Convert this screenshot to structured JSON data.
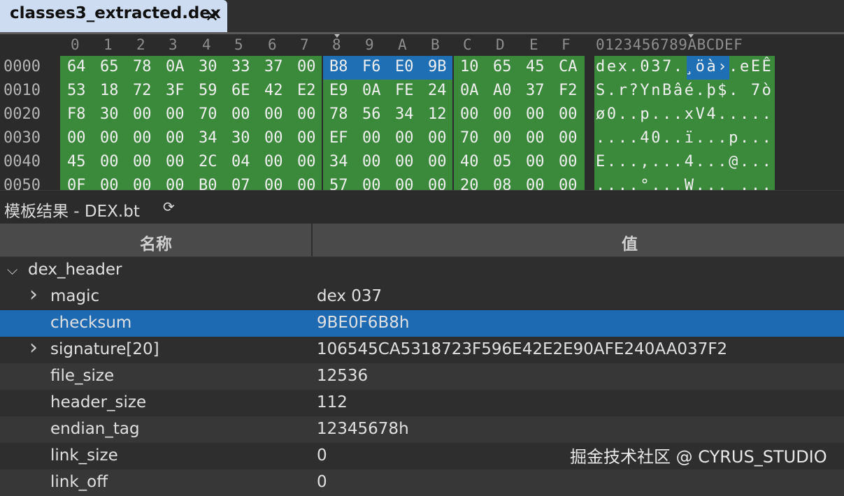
{
  "tab": {
    "title": "classes3_extracted.dex",
    "close": "✕"
  },
  "hex_header": {
    "columns": [
      "0",
      "1",
      "2",
      "3",
      "4",
      "5",
      "6",
      "7",
      "8",
      "9",
      "A",
      "B",
      "C",
      "D",
      "E",
      "F"
    ],
    "ascii_header": "0123456789ABCDEF"
  },
  "hex_rows": [
    {
      "offset": "0000",
      "bytes": [
        "64",
        "65",
        "78",
        "0A",
        "30",
        "33",
        "37",
        "00",
        "B8",
        "F6",
        "E0",
        "9B",
        "10",
        "65",
        "45",
        "CA"
      ],
      "ascii": "dex.037.¸öà›.eEÊ"
    },
    {
      "offset": "0010",
      "bytes": [
        "53",
        "18",
        "72",
        "3F",
        "59",
        "6E",
        "42",
        "E2",
        "E9",
        "0A",
        "FE",
        "24",
        "0A",
        "A0",
        "37",
        "F2"
      ],
      "ascii": "S.r?YnBâé.þ$. 7ò"
    },
    {
      "offset": "0020",
      "bytes": [
        "F8",
        "30",
        "00",
        "00",
        "70",
        "00",
        "00",
        "00",
        "78",
        "56",
        "34",
        "12",
        "00",
        "00",
        "00",
        "00"
      ],
      "ascii": "ø0..p...xV4....."
    },
    {
      "offset": "0030",
      "bytes": [
        "00",
        "00",
        "00",
        "00",
        "34",
        "30",
        "00",
        "00",
        "EF",
        "00",
        "00",
        "00",
        "70",
        "00",
        "00",
        "00"
      ],
      "ascii": "....40..ï...p..."
    },
    {
      "offset": "0040",
      "bytes": [
        "45",
        "00",
        "00",
        "00",
        "2C",
        "04",
        "00",
        "00",
        "34",
        "00",
        "00",
        "00",
        "40",
        "05",
        "00",
        "00"
      ],
      "ascii": "E...,...4...@..."
    },
    {
      "offset": "0050",
      "bytes": [
        "0F",
        "00",
        "00",
        "00",
        "B0",
        "07",
        "00",
        "00",
        "57",
        "00",
        "00",
        "00",
        "20",
        "08",
        "00",
        "00"
      ],
      "ascii": "....°...W... ..."
    }
  ],
  "panel": {
    "title": "模板结果 - DEX.bt",
    "refresh_icon": "refresh-icon"
  },
  "columns": {
    "name": "名称",
    "value": "值"
  },
  "tree": [
    {
      "name": "dex_header",
      "value": "",
      "level": 0,
      "expand": "expanded"
    },
    {
      "name": "magic",
      "value": "dex 037",
      "level": 1,
      "expand": "collapsed"
    },
    {
      "name": "checksum",
      "value": "9BE0F6B8h",
      "level": 1,
      "expand": "none",
      "selected": true
    },
    {
      "name": "signature[20]",
      "value": "106545CA5318723F596E42E2E90AFE240AA037F2",
      "level": 1,
      "expand": "collapsed"
    },
    {
      "name": "file_size",
      "value": "12536",
      "level": 1,
      "expand": "none"
    },
    {
      "name": "header_size",
      "value": "112",
      "level": 1,
      "expand": "none"
    },
    {
      "name": "endian_tag",
      "value": "12345678h",
      "level": 1,
      "expand": "none"
    },
    {
      "name": "link_size",
      "value": "0",
      "level": 1,
      "expand": "none"
    },
    {
      "name": "link_off",
      "value": "0",
      "level": 1,
      "expand": "none"
    }
  ],
  "watermark": "掘金技术社区 @ CYRUS_STUDIO",
  "colors": {
    "green": "#3b8a3b",
    "selection": "#1f6fb5",
    "tab": "#cddcf0"
  }
}
